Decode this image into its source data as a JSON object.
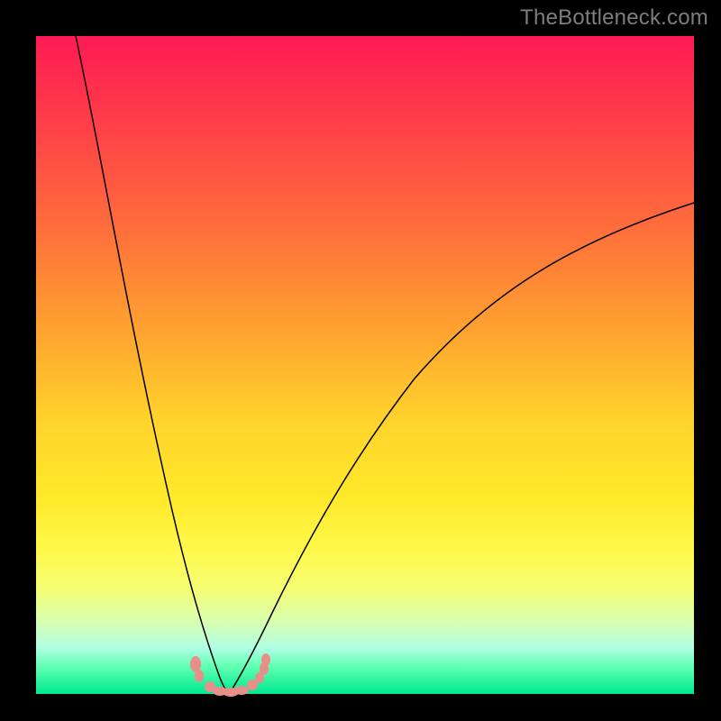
{
  "watermark": "TheBottleneck.com",
  "colors": {
    "frame": "#000000",
    "gradient_top": "#ff1a54",
    "gradient_mid": "#ffe92a",
    "gradient_bottom": "#00e890",
    "curve_stroke": "#000000",
    "marker_fill": "#e88f8a"
  },
  "chart_data": {
    "type": "line",
    "title": "",
    "xlabel": "",
    "ylabel": "",
    "xlim": [
      0,
      100
    ],
    "ylim": [
      0,
      100
    ],
    "grid": false,
    "legend": false,
    "annotations": [
      "TheBottleneck.com"
    ],
    "note": "Axes are implicit (no tick labels visible); values below are read as percentages of the plot area where x=0 is the left edge, x=100 is the right edge, y=0 is the bottom (green) edge, y=100 is the top (red) edge. The two black curves form a V meeting near x≈29. A short salmon-pink marker trail lies along the valley floor between x≈24 and x≈35.",
    "series": [
      {
        "name": "left-curve",
        "x": [
          6,
          10,
          14,
          18,
          22,
          24,
          26,
          28,
          29
        ],
        "y": [
          100,
          80,
          58,
          38,
          20,
          13,
          7,
          2,
          0
        ]
      },
      {
        "name": "right-curve",
        "x": [
          29,
          31,
          34,
          38,
          44,
          52,
          62,
          74,
          88,
          100
        ],
        "y": [
          0,
          3,
          8,
          16,
          27,
          40,
          52,
          62,
          70,
          75
        ]
      },
      {
        "name": "valley-markers",
        "x": [
          24,
          26,
          28,
          29,
          30,
          31,
          33,
          34,
          34.5
        ],
        "y": [
          4.5,
          1.8,
          0.6,
          0.2,
          0.2,
          0.4,
          1.4,
          3.0,
          5.0
        ]
      }
    ]
  }
}
